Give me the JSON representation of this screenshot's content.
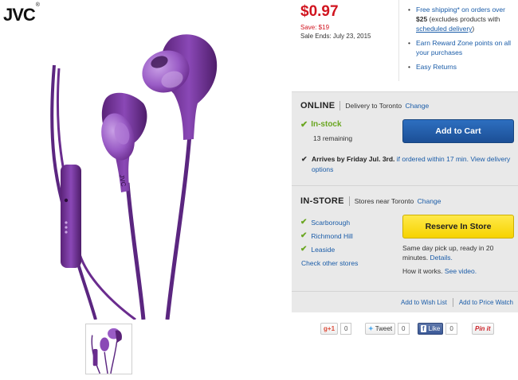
{
  "brand": {
    "name": "JVC",
    "mark": "®"
  },
  "pricing": {
    "price": "$0.97",
    "save": "Save: $19",
    "sale_ends": "Sale Ends: July 23, 2015"
  },
  "promos": [
    {
      "prefix": "Free shipping* on orders over ",
      "bold": "$25",
      "middle": " (excludes products with ",
      "link": "scheduled delivery",
      "suffix": ")"
    },
    {
      "text": "Earn Reward Zone points on all your purchases"
    },
    {
      "text": "Easy Returns"
    }
  ],
  "online": {
    "title": "ONLINE",
    "delivery_text": "Delivery to Toronto",
    "change_label": "Change",
    "stock_status": "In-stock",
    "remaining": "13 remaining",
    "add_to_cart": "Add to Cart",
    "arrives_bold": "Arrives by Friday Jul. 3rd.",
    "arrives_link": "if ordered within 17 min. View delivery options"
  },
  "instore": {
    "title": "IN-STORE",
    "stores_text": "Stores near Toronto",
    "change_label": "Change",
    "stores": [
      "Scarborough",
      "Richmond Hill",
      "Leaside"
    ],
    "check_other": "Check other stores",
    "reserve_label": "Reserve In Store",
    "pickup_text": "Same day pick up, ready in 20 minutes.",
    "details_label": "Details.",
    "how_it_works": "How it works.",
    "see_video": "See video."
  },
  "footer_links": {
    "wishlist": "Add to Wish List",
    "price_watch": "Add to Price Watch"
  },
  "social": {
    "gplus_label": "+1",
    "gplus_count": "0",
    "tweet_label": "Tweet",
    "tweet_count": "0",
    "like_label": "Like",
    "like_count": "0",
    "pin_label": "Pin it"
  },
  "colors": {
    "price_red": "#d1141f",
    "link_blue": "#1a5ca8",
    "stock_green": "#6aa621",
    "cart_blue": "#1c4f96",
    "reserve_yellow": "#f6d300",
    "panel_grey": "#e9e9e9",
    "product_purple": "#6a2c8e"
  }
}
